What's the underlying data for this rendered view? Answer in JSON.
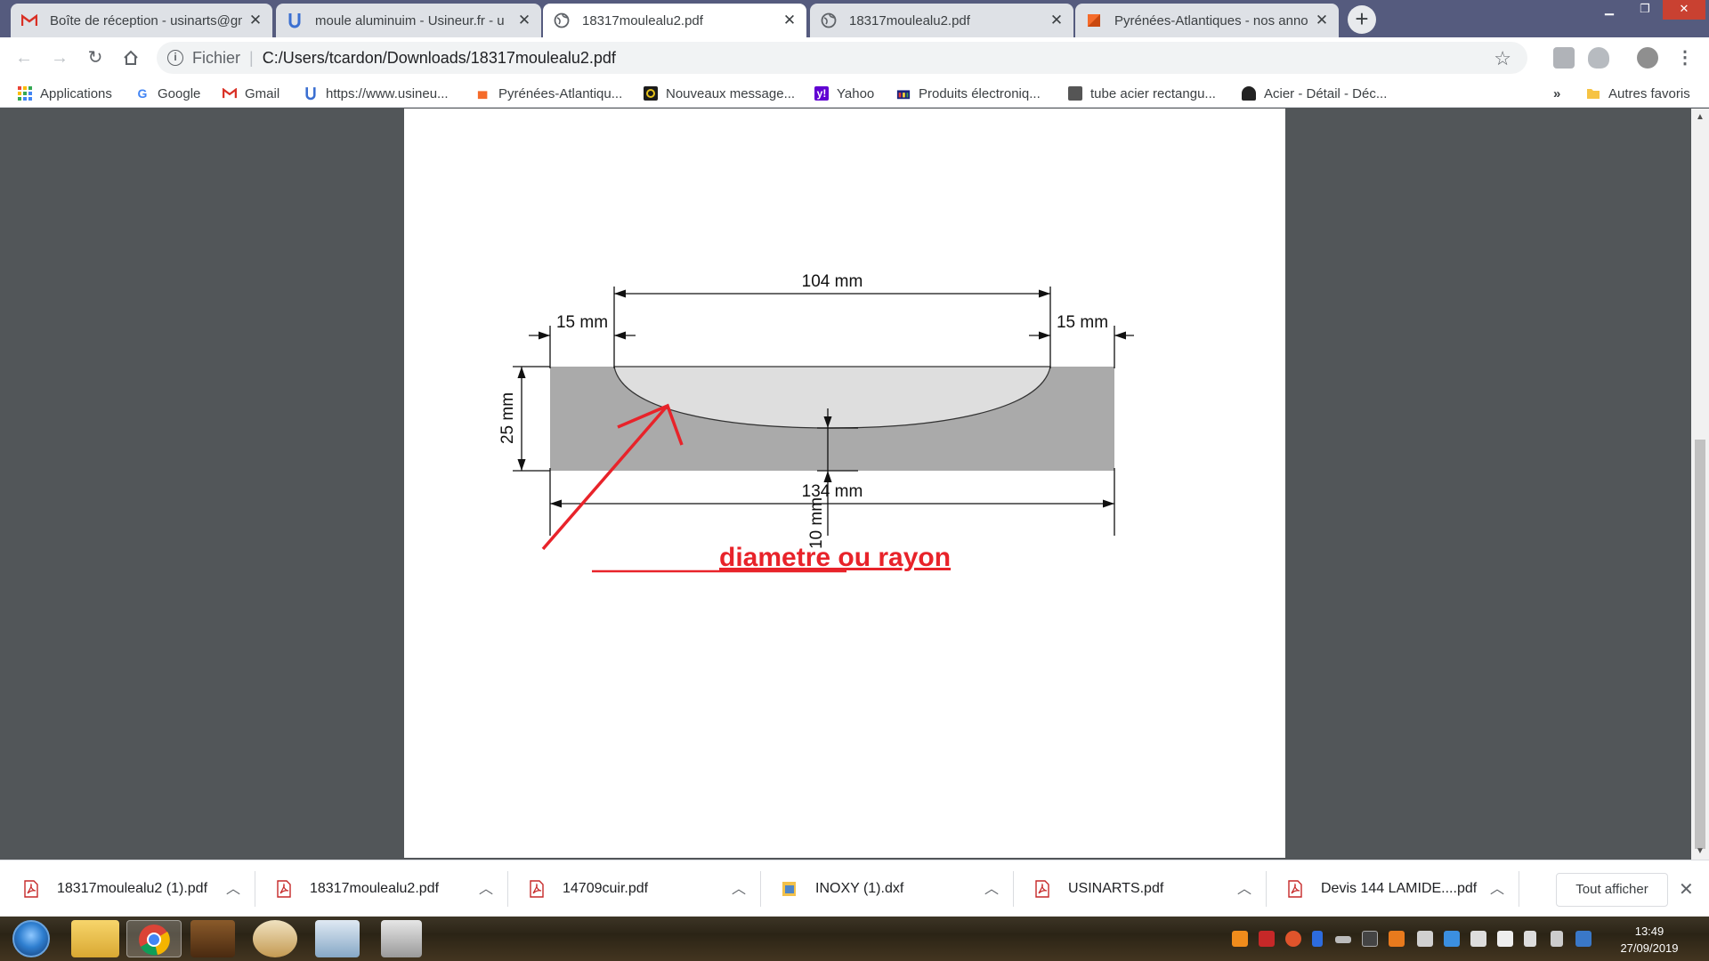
{
  "tabs": [
    {
      "title": "Boîte de réception - usinarts@gm",
      "icon": "gmail-icon",
      "active": false
    },
    {
      "title": "moule aluminuim - Usineur.fr - u",
      "icon": "usineur-icon",
      "active": false
    },
    {
      "title": "18317moulealu2.pdf",
      "icon": "globe-icon",
      "active": true
    },
    {
      "title": "18317moulealu2.pdf",
      "icon": "globe-icon",
      "active": false
    },
    {
      "title": "Pyrénées-Atlantiques - nos anno",
      "icon": "leboncoin-icon",
      "active": false
    }
  ],
  "toolbar": {
    "scheme_label": "Fichier",
    "url": "C:/Users/tcardon/Downloads/18317moulealu2.pdf"
  },
  "bookmarks": [
    {
      "label": "Applications",
      "icon": "apps-grid-icon"
    },
    {
      "label": "Google",
      "icon": "google-icon"
    },
    {
      "label": "Gmail",
      "icon": "gmail-icon"
    },
    {
      "label": "https://www.usineu...",
      "icon": "usineur-icon"
    },
    {
      "label": "Pyrénées-Atlantiqu...",
      "icon": "leboncoin-icon"
    },
    {
      "label": "Nouveaux message...",
      "icon": "forum-icon"
    },
    {
      "label": "Yahoo",
      "icon": "yahoo-icon"
    },
    {
      "label": "Produits électroniq...",
      "icon": "shop-icon"
    },
    {
      "label": "tube acier rectangu...",
      "icon": "site-icon"
    },
    {
      "label": "Acier - Détail - Déc...",
      "icon": "site-icon"
    }
  ],
  "bookmarks_more": "»",
  "other_bookmarks": "Autres favoris",
  "drawing": {
    "dim_top": "104 mm",
    "dim_left": "15 mm",
    "dim_right": "15 mm",
    "dim_height": "25 mm",
    "dim_bottom": "134 mm",
    "dim_floor": "10 mm",
    "annotation": "diametre ou rayon",
    "annotation_color": "#e8232a"
  },
  "downloads": [
    {
      "name": "18317moulealu2 (1).pdf",
      "icon": "pdf-icon"
    },
    {
      "name": "18317moulealu2.pdf",
      "icon": "pdf-icon"
    },
    {
      "name": "14709cuir.pdf",
      "icon": "pdf-icon"
    },
    {
      "name": "INOXY (1).dxf",
      "icon": "dxf-file-icon"
    },
    {
      "name": "USINARTS.pdf",
      "icon": "pdf-icon"
    },
    {
      "name": "Devis 144 LAMIDE....pdf",
      "icon": "pdf-icon"
    }
  ],
  "downloads_show_all": "Tout afficher",
  "clock": {
    "time": "13:49",
    "date": "27/09/2019"
  },
  "colors": {
    "accent_tab_bar": "#555b7e",
    "pdf_bg": "#525659"
  }
}
